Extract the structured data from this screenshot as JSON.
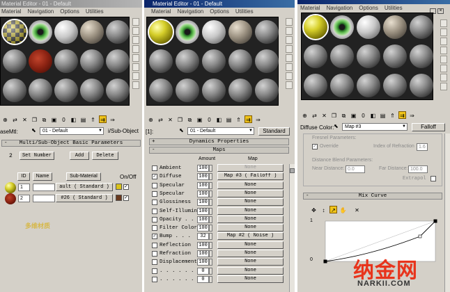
{
  "panel1": {
    "title": "Material Editor - 01 - Default",
    "menu": [
      "Material",
      "Navigation",
      "Options",
      "Utilities"
    ],
    "name_label": "aseMtl:",
    "material_name": "01 - Default",
    "type_button": "i/Sub-Object",
    "rollout_title": "Multi/Sub-Object Basic Parameters",
    "count_value": "2",
    "set_number_label": "Set Number",
    "add_label": "Add",
    "delete_label": "Delete",
    "col_id": "ID",
    "col_name": "Name",
    "col_submaterial": "Sub-Material",
    "col_onoff": "On/Off",
    "rows": [
      {
        "id": "1",
        "sub": "ault  ( Standard )",
        "color": "#d9c21a"
      },
      {
        "id": "2",
        "sub": "#26   ( Standard )",
        "color": "#6a3a1e"
      }
    ],
    "watermark_cn": "多维材质"
  },
  "panel2": {
    "title": "Material Editor - 01 - Default",
    "menu": [
      "Material",
      "Navigation",
      "Options",
      "Utilities"
    ],
    "name_label": "[1]:",
    "material_name": "01 - Default",
    "type_button": "Standard",
    "dynamics_title": "Dynamics Properties",
    "maps_title": "Maps",
    "col_amount": "Amount",
    "col_map": "Map",
    "rows": [
      {
        "label": "Ambient",
        "checked": false,
        "amt": "100",
        "map": "None",
        "dim": true
      },
      {
        "label": "Diffuse",
        "checked": true,
        "amt": "100",
        "map": "Map #3  ( Falloff )",
        "dim": false
      },
      {
        "label": "Specular",
        "checked": false,
        "amt": "100",
        "map": "None",
        "dim": false
      },
      {
        "label": "Specular",
        "checked": false,
        "amt": "100",
        "map": "None",
        "dim": false
      },
      {
        "label": "Glossiness",
        "checked": false,
        "amt": "100",
        "map": "None",
        "dim": false
      },
      {
        "label": "Self-Illumin",
        "checked": false,
        "amt": "100",
        "map": "None",
        "dim": false
      },
      {
        "label": "Opacity . .",
        "checked": false,
        "amt": "100",
        "map": "None",
        "dim": false
      },
      {
        "label": "Filter Color",
        "checked": false,
        "amt": "100",
        "map": "None",
        "dim": false
      },
      {
        "label": "Bump  . . .",
        "checked": true,
        "amt": "32",
        "map": "Map #2  ( Noise )",
        "dim": false
      },
      {
        "label": "Reflection",
        "checked": false,
        "amt": "100",
        "map": "None",
        "dim": false
      },
      {
        "label": "Refraction",
        "checked": false,
        "amt": "100",
        "map": "None",
        "dim": false
      },
      {
        "label": "Displacement",
        "checked": false,
        "amt": "100",
        "map": "None",
        "dim": false
      },
      {
        "label": ". . . . . . .",
        "checked": false,
        "amt": "0",
        "map": "None",
        "dim": false
      },
      {
        "label": ". . . . . . .",
        "checked": false,
        "amt": "0",
        "map": "None",
        "dim": false
      }
    ]
  },
  "panel3": {
    "menu": [
      "Material",
      "Navigation",
      "Options",
      "Utilities"
    ],
    "name_label": "Diffuse Color:",
    "material_name": "Map #3",
    "type_button": "Falloff",
    "fresnel_title": "Fresnel Parameters:",
    "override_label": "Override",
    "ior_label": "Index of Refraction",
    "ior_value": "1.6",
    "blend_title": "Distance Blend Parameters:",
    "near_label": "Near Distance:",
    "near_value": "0.0",
    "far_label": "Far Distance:",
    "far_value": "100.0",
    "extrapol_label": "Extrapol",
    "curve_title": "Mix Curve",
    "curve_y1": "1",
    "curve_y0": "0"
  },
  "watermark": {
    "brand_cn": "纳金网",
    "brand_url": "NARKII.COM"
  },
  "colors": {
    "title_active": "#0a246a",
    "panel_bg": "#d4d0c8",
    "slot_bg": "#222222",
    "accent_red": "#e8341c"
  }
}
